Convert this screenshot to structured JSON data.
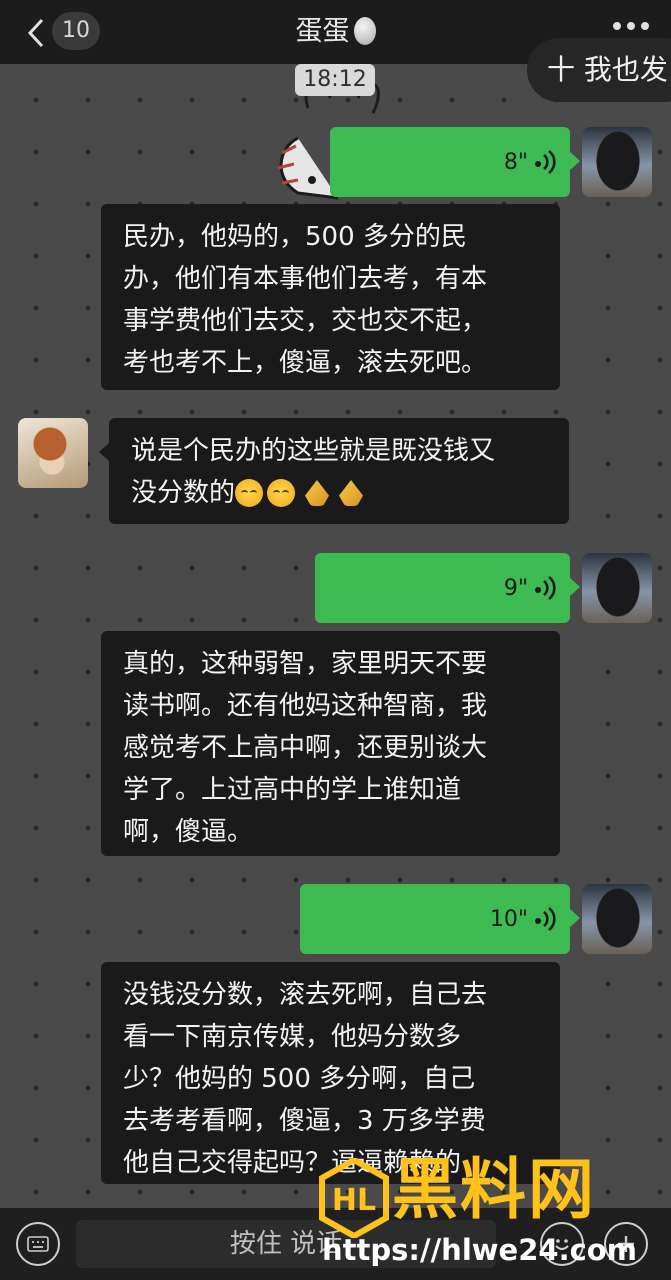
{
  "header": {
    "unread_count": "10",
    "title": "蛋蛋",
    "follow_button": "十 我也发"
  },
  "timestamp": "18:12",
  "messages": [
    {
      "type": "voice",
      "sender": "self",
      "duration": "8\""
    },
    {
      "type": "voice_text",
      "lines": [
        "民办，他妈的，500 多分的民",
        "办，他们有本事他们去考，有本",
        "事学费他们去交，交也交不起，",
        "考也考不上，傻逼，滚去死吧。"
      ]
    },
    {
      "type": "text",
      "sender": "other",
      "line1": "说是个民办的这些就是既没钱又",
      "line2": "没分数的",
      "emojis": [
        "crying-laughing-emoji",
        "crying-laughing-emoji",
        "folded-hands-emoji",
        "folded-hands-emoji"
      ]
    },
    {
      "type": "voice",
      "sender": "self",
      "duration": "9\""
    },
    {
      "type": "voice_text",
      "lines": [
        "真的，这种弱智，家里明天不要",
        "读书啊。还有他妈这种智商，我",
        "感觉考不上高中啊，还更别谈大",
        "学了。上过高中的学上谁知道",
        "啊，傻逼。"
      ]
    },
    {
      "type": "voice",
      "sender": "self",
      "duration": "10\""
    },
    {
      "type": "voice_text",
      "lines": [
        "没钱没分数，滚去死啊，自己去",
        "看一下南京传媒，他妈分数多",
        "少？他妈的 500 多分啊，自己",
        "去考考看啊，傻逼，3 万多学费",
        "他自己交得起吗？逼逼赖赖的"
      ]
    }
  ],
  "input_bar": {
    "hold_to_talk": "按住 说话"
  },
  "watermark": {
    "logo_text": "HL",
    "brand": "黑料网",
    "url": "https://hlwe24.com"
  },
  "colors": {
    "voice_bubble": "#3dba52",
    "text_bubble": "#1a1a1a",
    "watermark": "#ffc21a"
  }
}
